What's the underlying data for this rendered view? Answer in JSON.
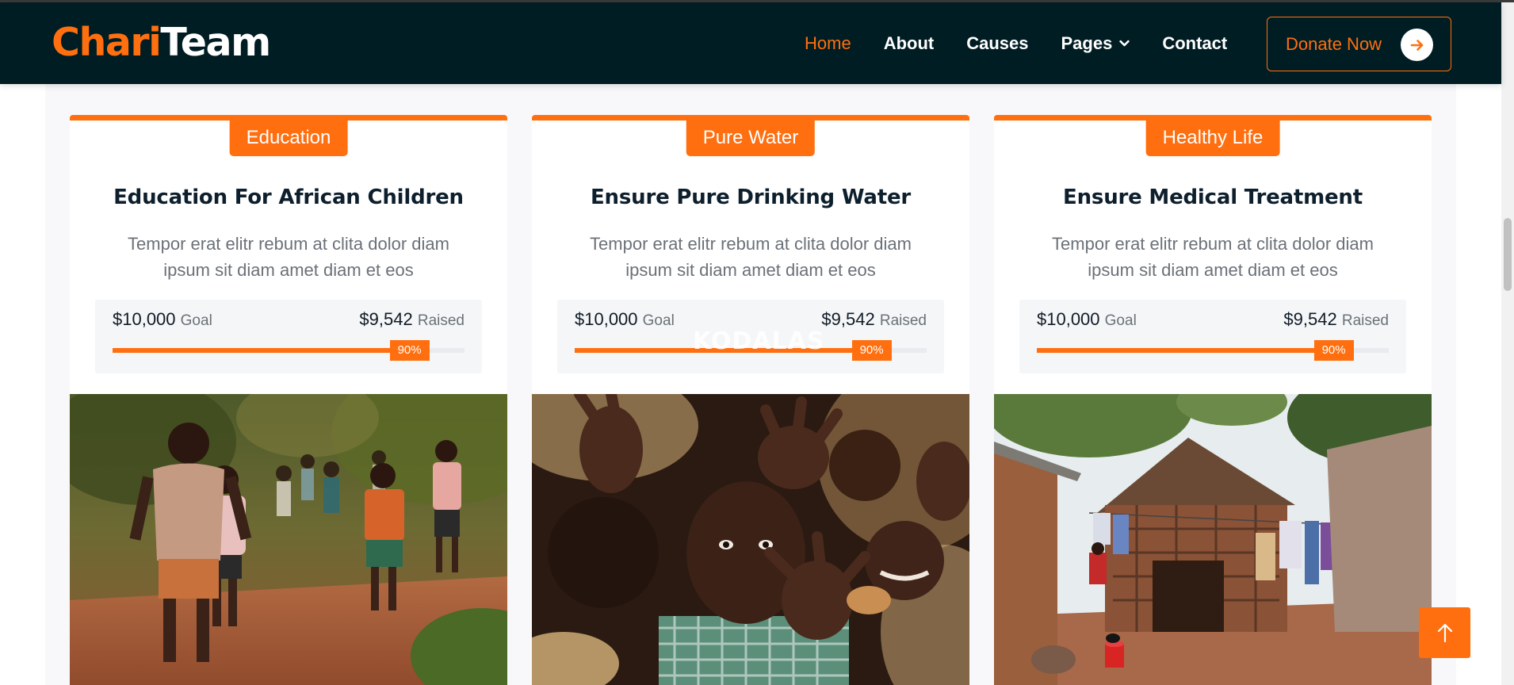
{
  "brand": {
    "part1": "Chari",
    "part2": "Team"
  },
  "nav": {
    "items": [
      {
        "label": "Home",
        "active": true
      },
      {
        "label": "About"
      },
      {
        "label": "Causes"
      },
      {
        "label": "Pages",
        "dropdown": true
      },
      {
        "label": "Contact"
      }
    ],
    "donate_label": "Donate Now"
  },
  "causes": [
    {
      "tag": "Education",
      "title": "Education For African Children",
      "description": "Tempor erat elitr rebum at clita dolor diam ipsum sit diam amet diam et eos",
      "goal_amount": "$10,000",
      "goal_label": "Goal",
      "raised_amount": "$9,542",
      "raised_label": "Raised",
      "progress_label": "90%",
      "progress": 0.9,
      "image": "children-running-on-dirt-path"
    },
    {
      "tag": "Pure Water",
      "title": "Ensure Pure Drinking Water",
      "description": "Tempor erat elitr rebum at clita dolor diam ipsum sit diam amet diam et eos",
      "goal_amount": "$10,000",
      "goal_label": "Goal",
      "raised_amount": "$9,542",
      "raised_label": "Raised",
      "progress_label": "90%",
      "progress": 0.9,
      "image": "children-reaching-hands"
    },
    {
      "tag": "Healthy Life",
      "title": "Ensure Medical Treatment",
      "description": "Tempor erat elitr rebum at clita dolor diam ipsum sit diam amet diam et eos",
      "goal_amount": "$10,000",
      "goal_label": "Goal",
      "raised_amount": "$9,542",
      "raised_label": "Raised",
      "progress_label": "90%",
      "progress": 0.9,
      "image": "mud-hut-village"
    }
  ],
  "watermark": "KODALAS",
  "icons": {
    "chevron": "chevron-down-icon",
    "donate": "arrow-right-icon",
    "scroll_top": "arrow-up-icon"
  },
  "colors": {
    "accent": "#ff6f0f",
    "navbar_bg": "#001d23",
    "title_text": "#0d1f2d",
    "body_text": "#6b7178"
  }
}
